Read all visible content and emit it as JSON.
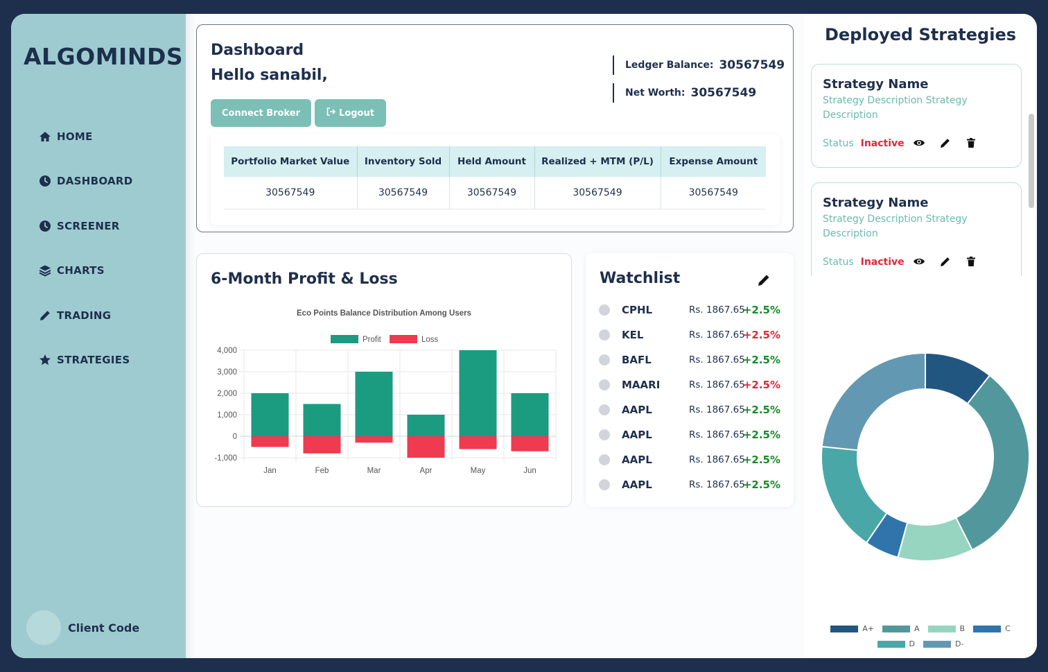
{
  "brand": "ALGOMINDS",
  "nav": [
    {
      "label": "HOME",
      "icon": "home-icon"
    },
    {
      "label": "DASHBOARD",
      "icon": "clock-icon"
    },
    {
      "label": "SCREENER",
      "icon": "clock-icon"
    },
    {
      "label": "CHARTS",
      "icon": "layers-icon"
    },
    {
      "label": "TRADING",
      "icon": "pencil-icon"
    },
    {
      "label": "STRATEGIES",
      "icon": "star-icon"
    }
  ],
  "client_code": "Client Code",
  "dashboard": {
    "title": "Dashboard",
    "greeting": "Hello sanabil,",
    "connect_label": "Connect Broker",
    "logout_label": "Logout",
    "ledger_label": "Ledger Balance:",
    "ledger_value": "30567549",
    "networth_label": "Net Worth:",
    "networth_value": "30567549",
    "table_headers": [
      "Portfolio Market Value",
      "Inventory Sold",
      "Held Amount",
      "Realized + MTM (P/L)",
      "Expense Amount"
    ],
    "table_row": [
      "30567549",
      "30567549",
      "30567549",
      "30567549",
      "30567549"
    ]
  },
  "pl": {
    "title": "6-Month Profit & Loss"
  },
  "chart_data": [
    {
      "type": "bar",
      "title": "Eco Points Balance Distribution Among Users",
      "categories": [
        "Jan",
        "Feb",
        "Mar",
        "Apr",
        "May",
        "Jun"
      ],
      "series": [
        {
          "name": "Profit",
          "values": [
            2000,
            1500,
            3000,
            1000,
            4000,
            2000
          ],
          "color": "#1b9b80"
        },
        {
          "name": "Loss",
          "values": [
            -500,
            -800,
            -300,
            -1000,
            -600,
            -700
          ],
          "color": "#ef3a4f"
        }
      ],
      "stacked": true,
      "ylim": [
        -1000,
        4000
      ],
      "yticks": [
        "4,000",
        "3,000",
        "2,000",
        "1,000",
        "0",
        "-1,000"
      ],
      "grid": true,
      "legend": "top"
    },
    {
      "type": "pie",
      "donut": true,
      "labels": [
        "A+",
        "A",
        "B",
        "C",
        "D",
        "D-"
      ],
      "values": [
        10,
        30,
        11,
        5,
        16,
        22
      ],
      "colors": [
        "#215680",
        "#52979c",
        "#97d5c1",
        "#3074ac",
        "#4aa7a8",
        "#6398b3"
      ],
      "legend": "bottom"
    }
  ],
  "watchlist": {
    "title": "Watchlist",
    "items": [
      {
        "symbol": "CPHL",
        "price": "Rs. 1867.65",
        "change": "+2.5%",
        "dir": "up"
      },
      {
        "symbol": "KEL",
        "price": "Rs. 1867.65",
        "change": "+2.5%",
        "dir": "down"
      },
      {
        "symbol": "BAFL",
        "price": "Rs. 1867.65",
        "change": "+2.5%",
        "dir": "up"
      },
      {
        "symbol": "MAARI",
        "price": "Rs. 1867.65",
        "change": "+2.5%",
        "dir": "down"
      },
      {
        "symbol": "AAPL",
        "price": "Rs. 1867.65",
        "change": "+2.5%",
        "dir": "up"
      },
      {
        "symbol": "AAPL",
        "price": "Rs. 1867.65",
        "change": "+2.5%",
        "dir": "up"
      },
      {
        "symbol": "AAPL",
        "price": "Rs. 1867.65",
        "change": "+2.5%",
        "dir": "up"
      },
      {
        "symbol": "AAPL",
        "price": "Rs. 1867.65",
        "change": "+2.5%",
        "dir": "up"
      }
    ]
  },
  "deployed": {
    "title": "Deployed Strategies",
    "strategies": [
      {
        "name": "Strategy Name",
        "description": "Strategy Description Strategy Description",
        "status_label": "Status",
        "status": "Inactive"
      },
      {
        "name": "Strategy Name",
        "description": "Strategy Description Strategy Description",
        "status_label": "Status",
        "status": "Inactive"
      }
    ]
  },
  "colors": {
    "navy": "#1e2f4d",
    "sidebar": "#9ecbd0",
    "button": "#7bbfb6",
    "profit": "#1b9b80",
    "loss": "#ef3a4f",
    "up": "#168a2a",
    "down": "#e0283b"
  }
}
